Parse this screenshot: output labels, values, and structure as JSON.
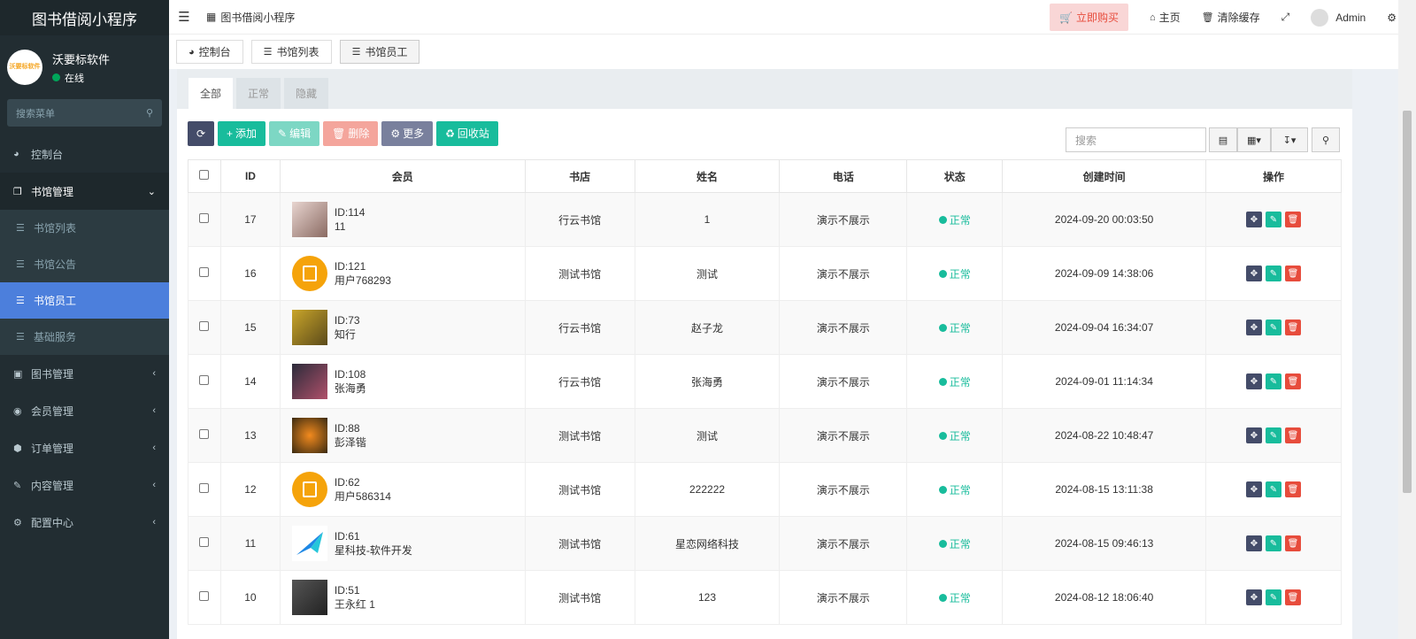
{
  "app": {
    "title": "图书借阅小程序"
  },
  "user": {
    "name": "沃要标软件",
    "status": "在线",
    "logo_text": "沃要标软件"
  },
  "sidebar": {
    "search_placeholder": "搜索菜单",
    "items": [
      {
        "label": "控制台",
        "icon": "dashboard-icon"
      },
      {
        "label": "书馆管理",
        "icon": "building-icon",
        "expanded": true
      },
      {
        "label": "图书管理",
        "icon": "book-icon"
      },
      {
        "label": "会员管理",
        "icon": "user-circle-icon"
      },
      {
        "label": "订单管理",
        "icon": "cube-icon"
      },
      {
        "label": "内容管理",
        "icon": "edit-icon"
      },
      {
        "label": "配置中心",
        "icon": "gear-icon"
      }
    ],
    "sub_items": [
      {
        "label": "书馆列表"
      },
      {
        "label": "书馆公告"
      },
      {
        "label": "书馆员工",
        "active": true
      },
      {
        "label": "基础服务"
      }
    ]
  },
  "header": {
    "app_tab": "图书借阅小程序",
    "buy": "立即购买",
    "home": "主页",
    "clear_cache": "清除缓存",
    "admin": "Admin"
  },
  "nav_tabs": [
    {
      "label": "控制台"
    },
    {
      "label": "书馆列表"
    },
    {
      "label": "书馆员工",
      "active": true
    }
  ],
  "filter_tabs": [
    {
      "label": "全部",
      "active": true
    },
    {
      "label": "正常"
    },
    {
      "label": "隐藏"
    }
  ],
  "toolbar": {
    "add": "添加",
    "edit": "编辑",
    "delete": "删除",
    "more": "更多",
    "recycle": "回收站",
    "search_placeholder": "搜索"
  },
  "table": {
    "columns": [
      "ID",
      "会员",
      "书店",
      "姓名",
      "电话",
      "状态",
      "创建时间",
      "操作"
    ],
    "rows": [
      {
        "id": "17",
        "member_id": "ID:114",
        "member_name": "11",
        "store": "行云书馆",
        "name": "1",
        "phone": "演示不展示",
        "status": "正常",
        "created": "2024-09-20 00:03:50",
        "avatar": "photo-pink"
      },
      {
        "id": "16",
        "member_id": "ID:121",
        "member_name": "用户768293",
        "store": "测试书馆",
        "name": "测试",
        "phone": "演示不展示",
        "status": "正常",
        "created": "2024-09-09 14:38:06",
        "avatar": "circle-orange"
      },
      {
        "id": "15",
        "member_id": "ID:73",
        "member_name": "知行",
        "store": "行云书馆",
        "name": "赵子龙",
        "phone": "演示不展示",
        "status": "正常",
        "created": "2024-09-04 16:34:07",
        "avatar": "photo-yellow"
      },
      {
        "id": "14",
        "member_id": "ID:108",
        "member_name": "张海勇",
        "store": "行云书馆",
        "name": "张海勇",
        "phone": "演示不展示",
        "status": "正常",
        "created": "2024-09-01 11:14:34",
        "avatar": "photo-dark"
      },
      {
        "id": "13",
        "member_id": "ID:88",
        "member_name": "彭泽锴",
        "store": "测试书馆",
        "name": "测试",
        "phone": "演示不展示",
        "status": "正常",
        "created": "2024-08-22 10:48:47",
        "avatar": "photo-orange"
      },
      {
        "id": "12",
        "member_id": "ID:62",
        "member_name": "用户586314",
        "store": "测试书馆",
        "name": "222222",
        "phone": "演示不展示",
        "status": "正常",
        "created": "2024-08-15 13:11:38",
        "avatar": "circle-orange"
      },
      {
        "id": "11",
        "member_id": "ID:61",
        "member_name": "星科技-软件开发",
        "store": "测试书馆",
        "name": "星恋网络科技",
        "phone": "演示不展示",
        "status": "正常",
        "created": "2024-08-15 09:46:13",
        "avatar": "logo-blue"
      },
      {
        "id": "10",
        "member_id": "ID:51",
        "member_name": "王永红 1",
        "store": "测试书馆",
        "name": "123",
        "phone": "演示不展示",
        "status": "正常",
        "created": "2024-08-12 18:06:40",
        "avatar": "photo-gray"
      }
    ]
  }
}
